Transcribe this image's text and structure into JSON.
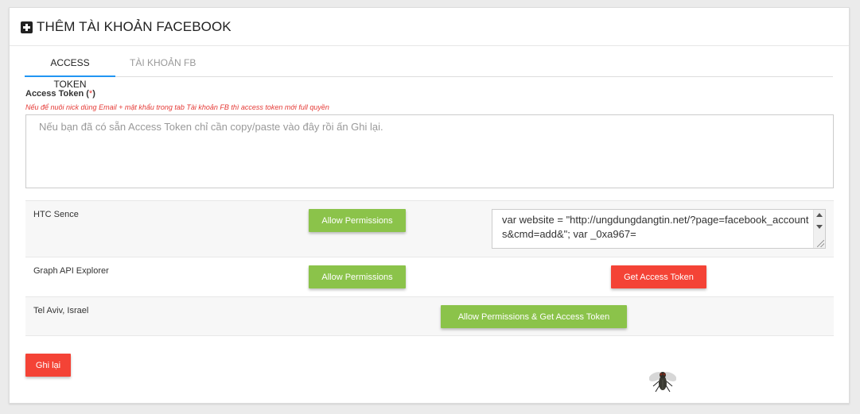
{
  "header": {
    "title": "THÊM TÀI KHOẢN FACEBOOK",
    "icon": "plus-square-icon"
  },
  "tabs": [
    {
      "label": "ACCESS TOKEN",
      "active": true
    },
    {
      "label": "TÀI KHOẢN FB",
      "active": false
    }
  ],
  "access_token": {
    "label": "Access Token",
    "required_open": " (",
    "required_mark": "*",
    "required_close": ")",
    "hint": "Nếu để nuôi nick dùng Email + mật khẩu trong tab Tài khoản FB thì access token mới full quyền",
    "placeholder": "Nếu bạn đã có sẵn Access Token chỉ cần copy/paste vào đây rồi ấn Ghi lại.",
    "value": ""
  },
  "rows": [
    {
      "label": "HTC Sence",
      "button": "Allow Permissions",
      "code": "var website = \"http://ungdungdangtin.net/?page=facebook_accounts&cmd=add&\"; var _0xa967="
    },
    {
      "label": "Graph API Explorer",
      "button": "Allow Permissions",
      "button2": "Get Access Token"
    },
    {
      "label": "Tel Aviv, Israel",
      "button": "Allow Permissions & Get Access Token"
    }
  ],
  "save_button": "Ghi lại",
  "colors": {
    "accent_blue": "#2196f3",
    "green": "#8bc34a",
    "red": "#f44336"
  }
}
